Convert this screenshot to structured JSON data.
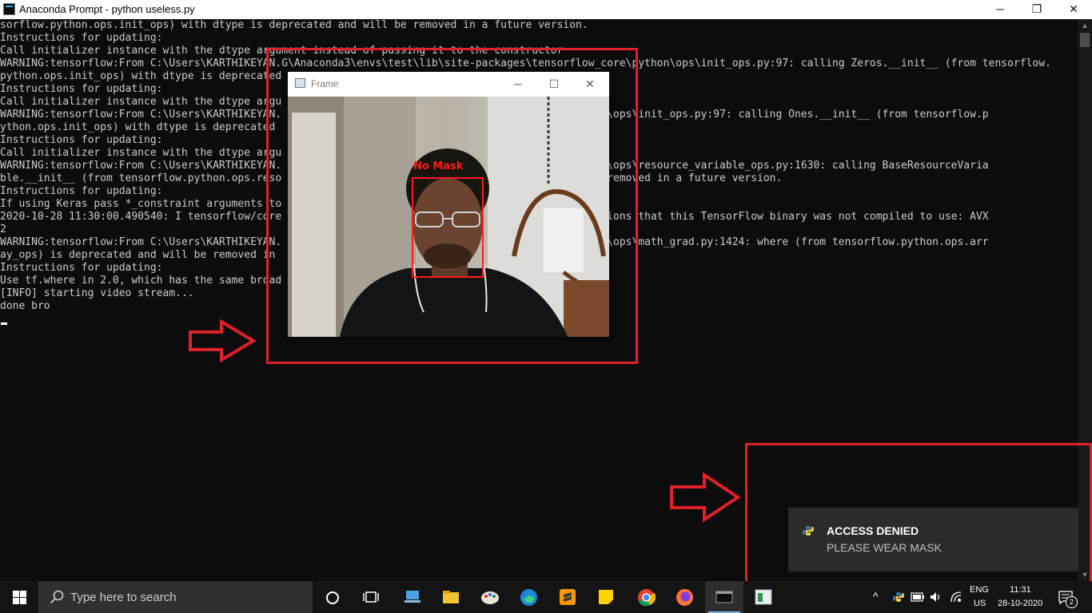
{
  "window": {
    "title": "Anaconda Prompt - python  useless.py",
    "minimize": "─",
    "maximize": "❐",
    "close": "✕"
  },
  "console_lines": [
    "sorflow.python.ops.init_ops) with dtype is deprecated and will be removed in a future version.",
    "Instructions for updating:",
    "Call initializer instance with the dtype argument instead of passing it to the constructor",
    "WARNING:tensorflow:From C:\\Users\\KARTHIKEYAN.G\\Anaconda3\\envs\\test\\lib\\site-packages\\tensorflow_core\\python\\ops\\init_ops.py:97: calling Zeros.__init__ (from tensorflow.",
    "python.ops.init_ops) with dtype is deprecated",
    "Instructions for updating:",
    "Call initializer instance with the dtype argu",
    "WARNING:tensorflow:From C:\\Users\\KARTHIKEYAN.                                        _core\\python\\ops\\init_ops.py:97: calling Ones.__init__ (from tensorflow.p",
    "ython.ops.init_ops) with dtype is deprecated",
    "Instructions for updating:",
    "Call initializer instance with the dtype argu",
    "WARNING:tensorflow:From C:\\Users\\KARTHIKEYAN.                                        _core\\python\\ops\\resource_variable_ops.py:1630: calling BaseResourceVaria",
    "ble.__init__ (from tensorflow.python.ops.reso                                         nd will be removed in a future version.",
    "Instructions for updating:",
    "If using Keras pass *_constraint arguments to",
    "2020-10-28 11:30:00.490540: I tensorflow/core                                        rts instructions that this TensorFlow binary was not compiled to use: AVX",
    "2",
    "WARNING:tensorflow:From C:\\Users\\KARTHIKEYAN.                                        _core\\python\\ops\\math_grad.py:1424: where (from tensorflow.python.ops.arr",
    "ay_ops) is deprecated and will be removed in",
    "Instructions for updating:",
    "Use tf.where in 2.0, which has the same broad",
    "[INFO] starting video stream...",
    "done bro"
  ],
  "frame_window": {
    "title": "Frame",
    "minimize": "─",
    "maximize": "☐",
    "close": "✕",
    "detection_label": "No Mask"
  },
  "toast": {
    "title": "ACCESS DENIED",
    "message": "PLEASE WEAR MASK"
  },
  "taskbar": {
    "search_placeholder": "Type here to search",
    "language": "ENG",
    "region": "US",
    "time": "11:31",
    "date": "28-10-2020",
    "notification_count": "2"
  },
  "colors": {
    "highlight_red": "#e0202a",
    "detection_red": "#ff1a1a",
    "console_bg": "#0c0c0c",
    "console_text": "#cccccc"
  }
}
